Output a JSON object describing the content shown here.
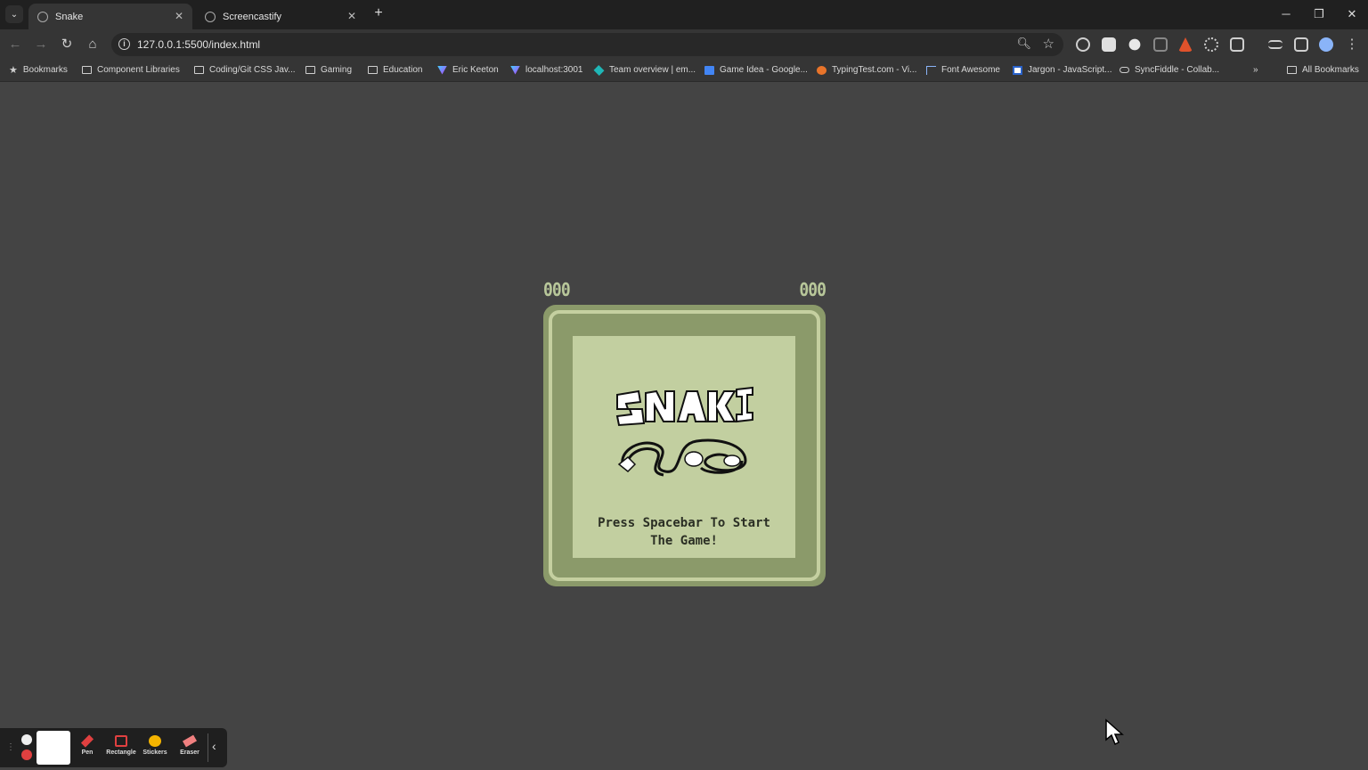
{
  "browser": {
    "tabs": [
      {
        "title": "Snake",
        "active": true
      },
      {
        "title": "Screencastify",
        "active": false
      }
    ],
    "address": "127.0.0.1:5500/index.html",
    "bookmarks": [
      {
        "label": "Bookmarks",
        "icon": "star-icon"
      },
      {
        "label": "Component Libraries",
        "icon": "folder-icon"
      },
      {
        "label": "Coding/Git CSS Jav...",
        "icon": "folder-icon"
      },
      {
        "label": "Gaming",
        "icon": "folder-icon"
      },
      {
        "label": "Education",
        "icon": "folder-icon"
      },
      {
        "label": "Eric Keeton",
        "icon": "vite-icon"
      },
      {
        "label": "localhost:3001",
        "icon": "vite-icon"
      },
      {
        "label": "Team overview | em...",
        "icon": "diamond-icon"
      },
      {
        "label": "Game Idea - Google...",
        "icon": "docs-icon"
      },
      {
        "label": "TypingTest.com - Vi...",
        "icon": "typingtest-icon"
      },
      {
        "label": "Font Awesome",
        "icon": "flag-icon"
      },
      {
        "label": "Jargon - JavaScript...",
        "icon": "jargon-icon"
      },
      {
        "label": "SyncFiddle - Collab...",
        "icon": "cloud-icon"
      }
    ],
    "all_bookmarks": "All Bookmarks"
  },
  "game": {
    "score_left": "000",
    "score_right": "000",
    "prompt_line1": "Press Spacebar To Start",
    "prompt_line2": "The Game!",
    "colors": {
      "console": "#8b9a6a",
      "screen": "#c2cfa0",
      "border": "#c5d0a0"
    }
  },
  "screencastify": {
    "tools": [
      "Pen",
      "Rectangle",
      "Stickers",
      "Eraser"
    ]
  }
}
